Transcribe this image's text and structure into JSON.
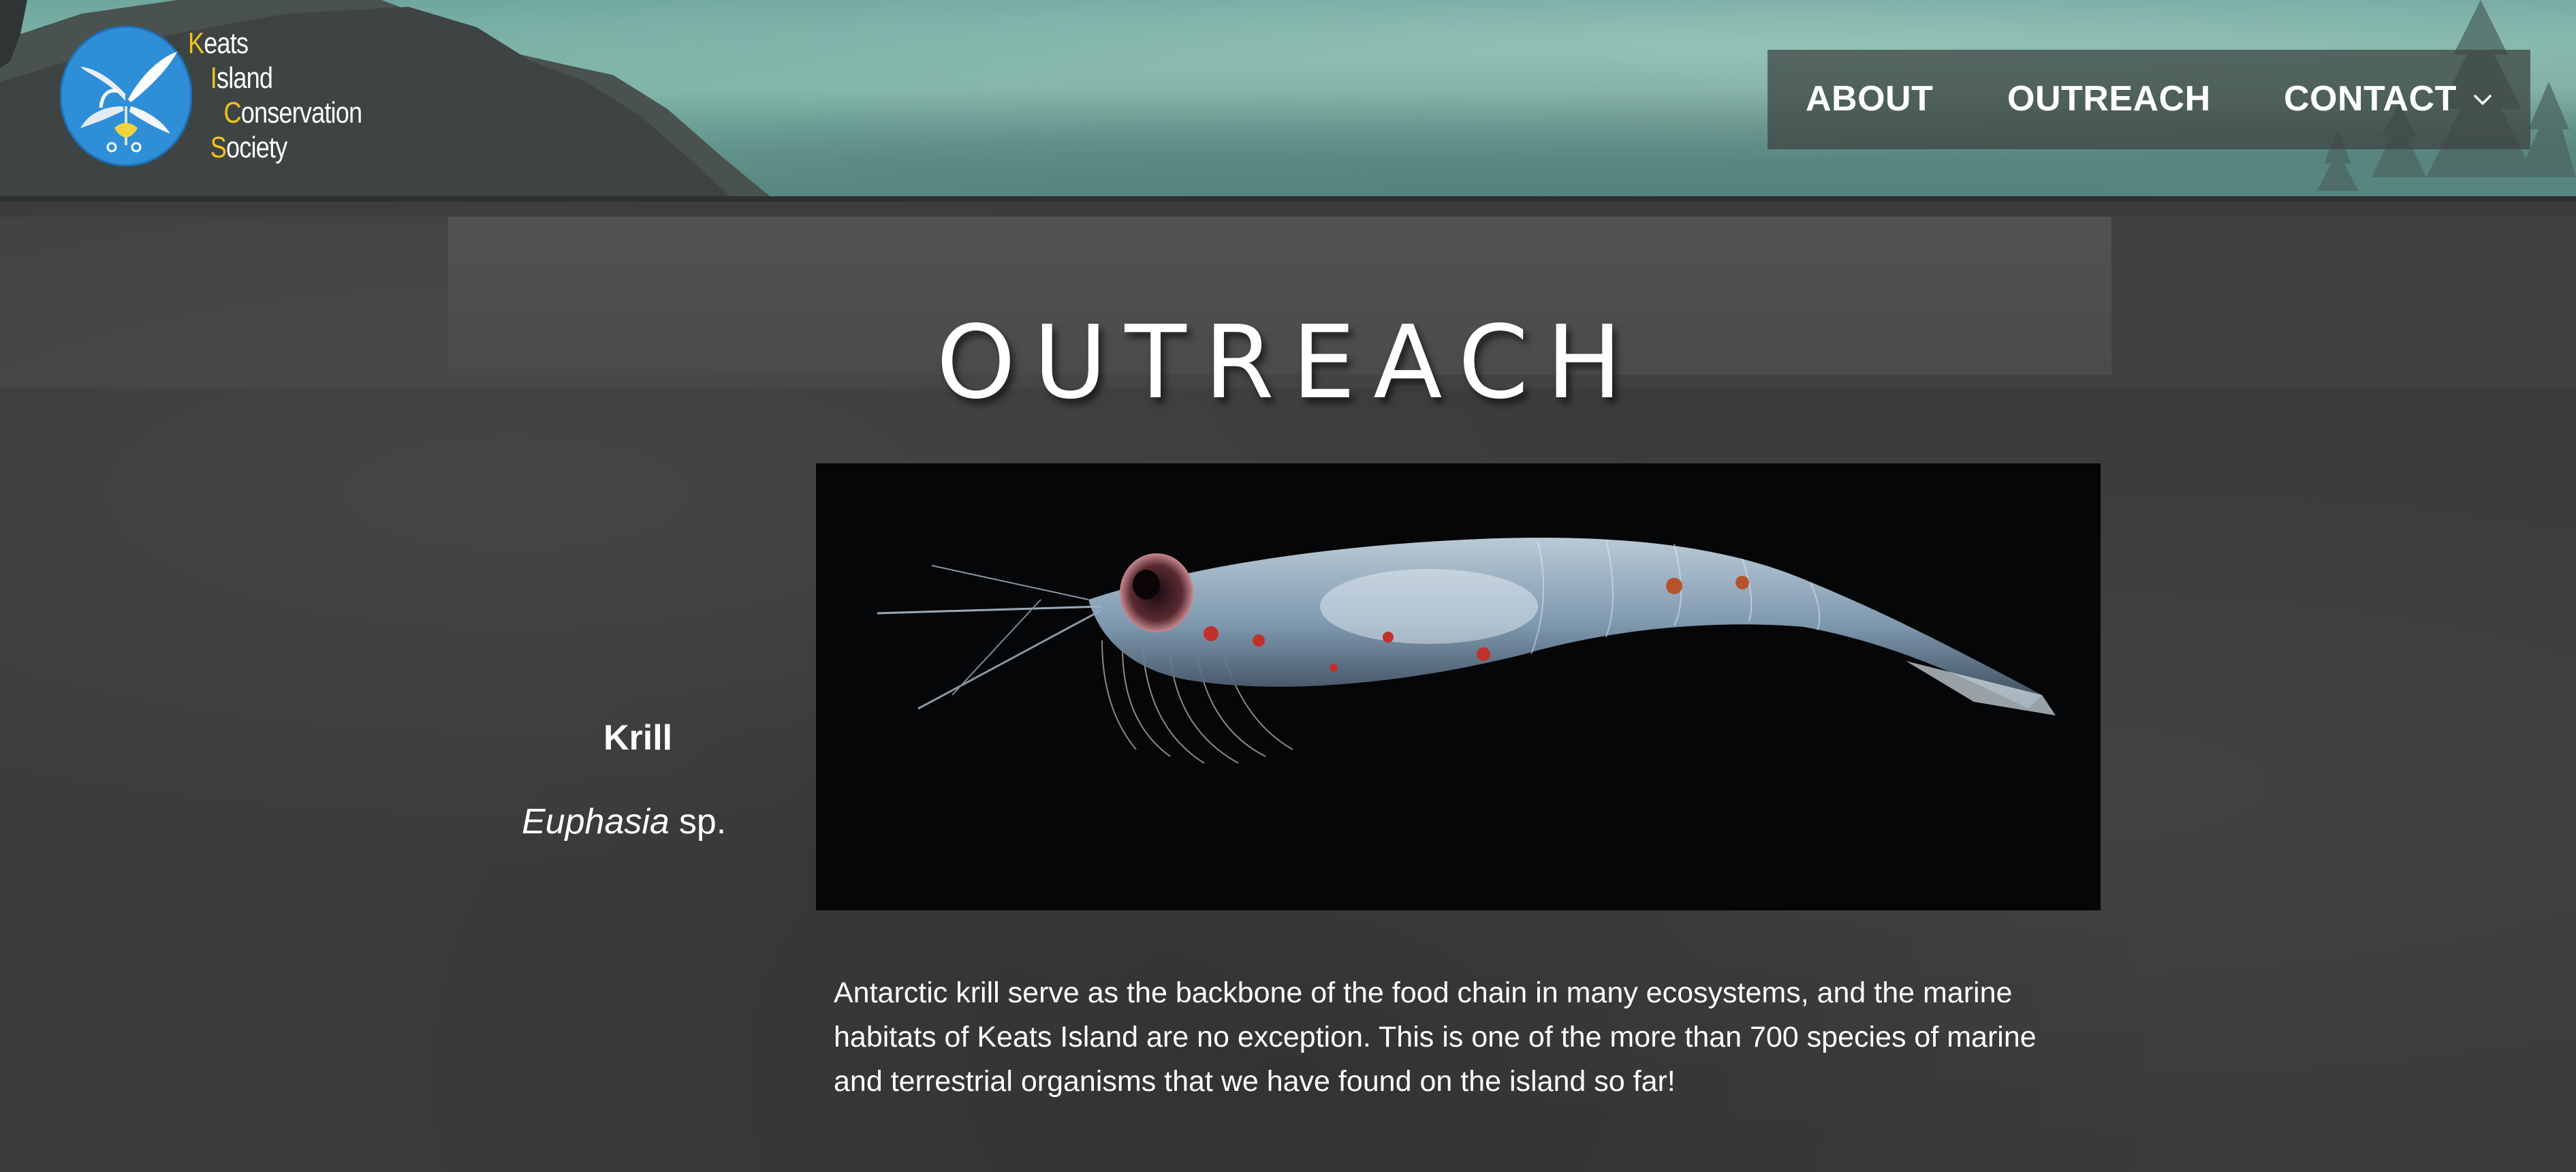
{
  "header": {
    "logo": {
      "lines": [
        {
          "cap": "K",
          "rest": "eats"
        },
        {
          "cap": "I",
          "rest": "sland"
        },
        {
          "cap": "C",
          "rest": "onservation"
        },
        {
          "cap": "S",
          "rest": "ociety"
        }
      ],
      "icon": "flower-logo-icon"
    },
    "nav": {
      "items": [
        {
          "label": "ABOUT"
        },
        {
          "label": "OUTREACH"
        },
        {
          "label": "CONTACT",
          "icon": "chevron-down-icon"
        }
      ]
    }
  },
  "main": {
    "title": "OUTREACH",
    "species": {
      "common_name": "Krill",
      "genus": "Euphasia",
      "suffix": "sp."
    },
    "description": "Antarctic krill serve as the backbone of the food chain in many ecosystems, and the marine habitats of Keats Island are no exception. This is one of the more than 700 species of marine and terrestrial organisms that we have found on the island so far!"
  },
  "colors": {
    "accent_gold": "#f2c21b",
    "nav_bg": "#3c4240",
    "page_bg": "#3b3b3b",
    "header_teal": "#8cc1b4"
  }
}
